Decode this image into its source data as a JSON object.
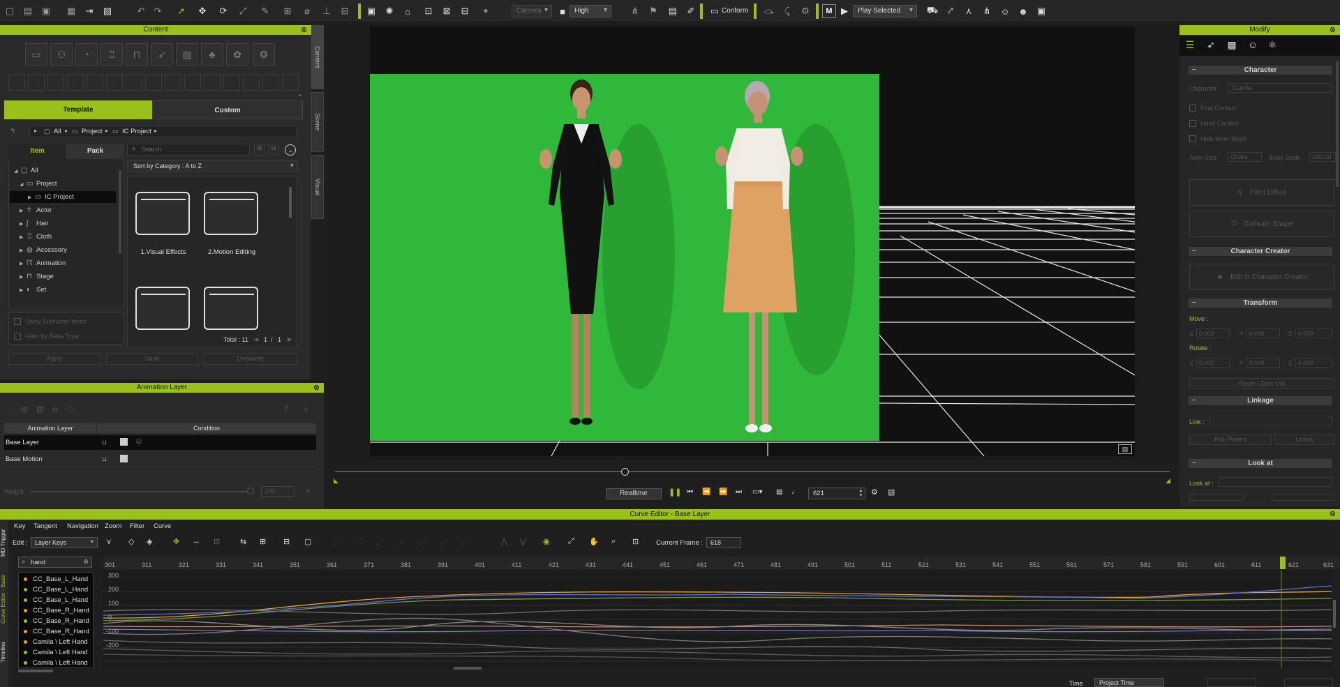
{
  "toolbar": {
    "camera_dropdown": "Camera",
    "quality_dropdown": "High",
    "conform_label": "Conform",
    "play_dropdown": "Play Selected",
    "md_label": "M"
  },
  "content_panel": {
    "title": "Content",
    "tabs": {
      "template": "Template",
      "custom": "Custom"
    },
    "breadcrumb": [
      "All",
      "Project",
      "IC Project"
    ],
    "subtabs": {
      "item": "Item",
      "pack": "Pack"
    },
    "search_placeholder": "Search",
    "sort_label": "Sort by Category : A to Z",
    "tree": {
      "all": "All",
      "project": "Project",
      "ic_project": "IC Project",
      "actor": "Actor",
      "hair": "Hair",
      "cloth": "Cloth",
      "accessory": "Accessory",
      "animation": "Animation",
      "stage": "Stage",
      "set": "Set"
    },
    "folders": [
      "1.Visual Effects",
      "2.Motion Editing",
      "",
      ""
    ],
    "show_subfolder": "Show Subfolder Items",
    "filter_base": "Filter by Base Type",
    "total": "Total : 11",
    "page_current": "1",
    "page_sep": "/",
    "page_total": "1",
    "apply": "Apply",
    "save": "Save",
    "overwrite": "Overwrite"
  },
  "side_tabs": {
    "content": "Content",
    "scene": "Scene",
    "visual": "Visual"
  },
  "animation_layer": {
    "title": "Animation Layer",
    "col_layer": "Animation Layer",
    "col_condition": "Condition",
    "rows": [
      "Base Layer",
      "Base Motion"
    ],
    "weight_label": "Weight",
    "weight_value": "100"
  },
  "viewport": {
    "realtime_label": "Realtime",
    "frame_value": "621"
  },
  "modify_panel": {
    "title": "Modify",
    "character_header": "Character",
    "character_label": "Character",
    "character_value": "Camila",
    "foot_contact": "Foot Contact",
    "hand_contact": "Hand Contact",
    "hide_inner_mesh": "Hide Inner Mesh",
    "auto_size": "Auto-Size",
    "auto_size_value": "Chara",
    "body_scale": "Body Scale",
    "body_scale_value": "100.00",
    "pivot_offset": "Pivot Offset",
    "collision_shape": "Collision Shape",
    "creator_header": "Character Creator",
    "edit_in_cc": "Edit in Character Creator",
    "transform_header": "Transform",
    "move_label": "Move :",
    "move_values": [
      "0.000",
      "0.000",
      "0.000"
    ],
    "rotate_label": "Rotate :",
    "rotate_values": [
      "0.000",
      "0.000",
      "0.000"
    ],
    "axis": [
      "X",
      "Y",
      "Z"
    ],
    "reset_zero": "Reset / Zero Out",
    "linkage_header": "Linkage",
    "link_label": "Link :",
    "pick_parent": "Pick Parent",
    "unlink": "Unlink",
    "lookat_header": "Look at",
    "lookat_label": "Look at :"
  },
  "curve_editor": {
    "title": "Curve Editor - Base Layer",
    "menu": [
      "Key",
      "Tangent",
      "Navigation",
      "Zoom",
      "Filter",
      "Curve"
    ],
    "edit_label": "Edit :",
    "edit_value": "Layer Keys",
    "current_frame_label": "Current Frame :",
    "current_frame_value": "618",
    "search_value": "hand",
    "ruler": [
      "301",
      "311",
      "321",
      "331",
      "341",
      "351",
      "361",
      "371",
      "381",
      "391",
      "401",
      "411",
      "421",
      "431",
      "441",
      "451",
      "461",
      "471",
      "481",
      "491",
      "501",
      "511",
      "521",
      "531",
      "541",
      "551",
      "561",
      "571",
      "581",
      "591",
      "601",
      "611",
      "621",
      "631"
    ],
    "y_labels": [
      "300",
      "200",
      "100",
      "0",
      "-100",
      "-200"
    ],
    "curves": [
      {
        "name": "CC_Base_L_Hand",
        "color": "#e8a317"
      },
      {
        "name": "CC_Base_L_Hand",
        "color": "#9ac11b"
      },
      {
        "name": "CC_Base_L_Hand",
        "color": "#9ac11b"
      },
      {
        "name": "CC_Base_R_Hand",
        "color": "#e8a317"
      },
      {
        "name": "CC_Base_R_Hand",
        "color": "#9ac11b"
      },
      {
        "name": "CC_Base_R_Hand",
        "color": "#e8a317"
      },
      {
        "name": "Camila \\ Left Hand",
        "color": "#e8a317"
      },
      {
        "name": "Camila \\ Left Hand",
        "color": "#9ac11b"
      },
      {
        "name": "Camila \\ Left Hand",
        "color": "#9ac11b"
      }
    ],
    "side_tabs": [
      "MD Trigger",
      "Curve Editor - Base",
      "Timeline"
    ],
    "time_label": "Time",
    "time_value": "Project Time"
  },
  "colors": {
    "accent": "#9ac11b",
    "green_screen": "#2fb83a",
    "panel": "#2a2a2a"
  }
}
